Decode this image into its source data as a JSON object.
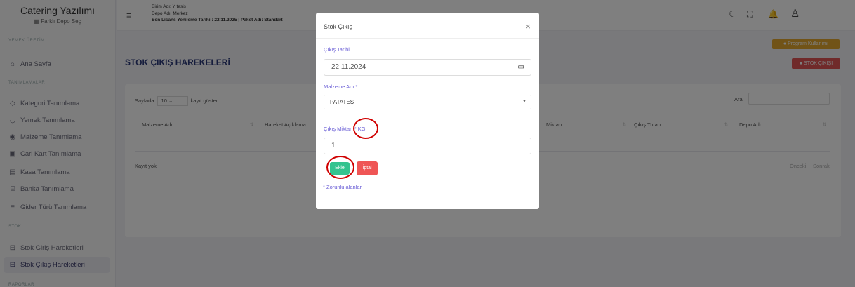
{
  "sidebar": {
    "title": "Catering Yazılımı",
    "subtitle": "Farklı Depo Seç",
    "sections": [
      "YEMEK ÜRETİM",
      "TANIMLAMALAR",
      "STOK",
      "RAPORLAR"
    ],
    "items": [
      "Ana Sayfa",
      "Kategori Tanımlama",
      "Yemek Tanımlama",
      "Malzeme Tanımlama",
      "Cari Kart Tanımlama",
      "Kasa Tanımlama",
      "Banka Tanımlama",
      "Gider Türü Tanımlama",
      "Stok Giriş Hareketleri",
      "Stok Çıkış Hareketleri"
    ]
  },
  "header": {
    "line1": "Birim Adı: Y tesis",
    "line2": "Depo Adı: Merkez",
    "line3": "Son Lisans Yenileme Tarihi : 22.11.2025 | Paket Adı: Standart"
  },
  "page": {
    "title": "STOK ÇIKIŞ HAREKELERİ",
    "help_button": "Program Kullanımı",
    "add_button": "STOK ÇIKIŞI"
  },
  "table": {
    "show_prefix": "Sayfada",
    "page_size": "10",
    "show_suffix": "kayıt göster",
    "search_label": "Ara:",
    "columns": [
      "Malzeme Adı",
      "Hareket Açıklama",
      "Miktarı",
      "Çıkış Tutarı",
      "Depo Adı"
    ],
    "empty": "Kayıt yok",
    "prev": "Önceki",
    "next": "Sonraki"
  },
  "modal": {
    "title": "Stok Çıkış",
    "date_label": "Çıkış Tarihi",
    "date_value": "22.11.2024",
    "material_label": "Malzeme Adı *",
    "material_value": "PATATES",
    "qty_label": "Çıkış Miktarı",
    "qty_unit": "* KG",
    "qty_value": "1",
    "save": "Ekle",
    "cancel": "İptal",
    "required_note": "* Zorunlu alanlar"
  },
  "colors": {
    "accent": "#6b5fd6",
    "success": "#34c38f",
    "danger": "#ef5555",
    "warning": "#e2a72e",
    "annotation": "#d00000"
  }
}
